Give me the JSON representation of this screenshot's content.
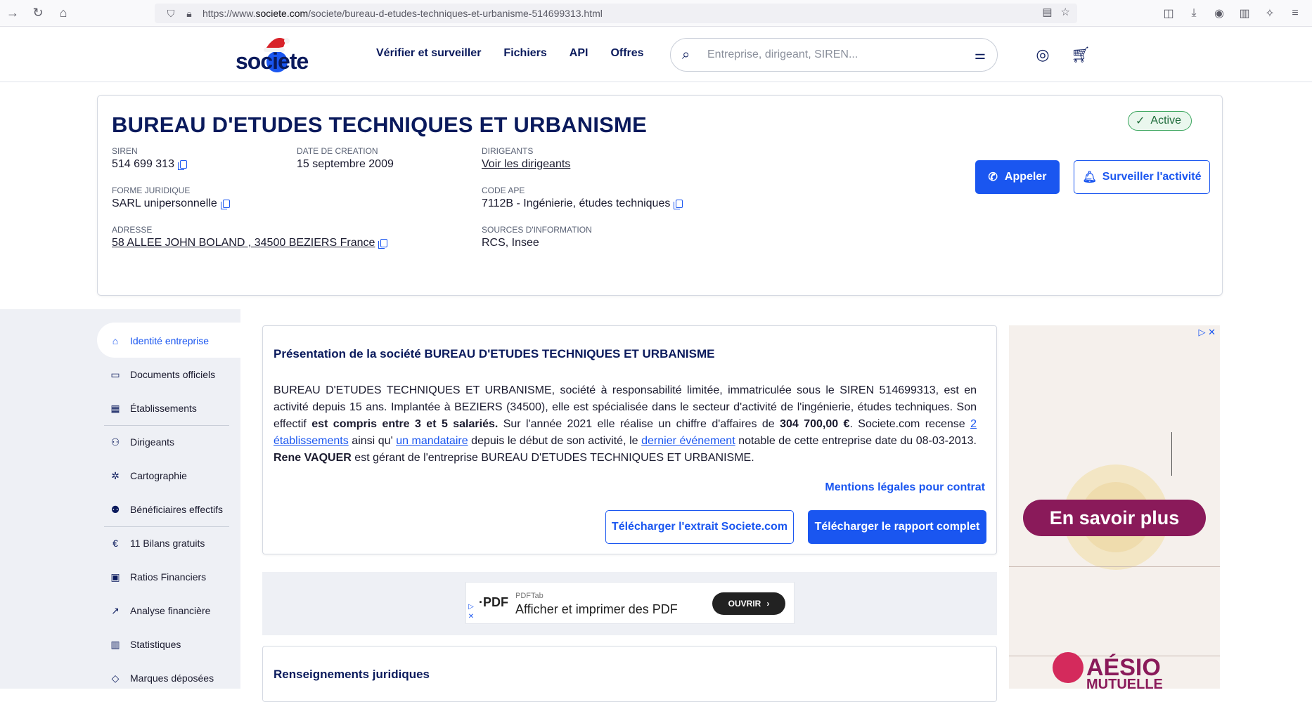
{
  "browser": {
    "url_prefix": "https://www.",
    "url_domain": "societe.com",
    "url_path": "/societe/bureau-d-etudes-techniques-et-urbanisme-514699313.html"
  },
  "header": {
    "logo_text": "societe",
    "nav": [
      "Vérifier et surveiller",
      "Fichiers",
      "API",
      "Offres"
    ],
    "search_placeholder": "Entreprise, dirigeant, SIREN..."
  },
  "company": {
    "name": "BUREAU D'ETUDES TECHNIQUES ET URBANISME",
    "status": "Active",
    "siren_label": "SIREN",
    "siren": "514 699 313",
    "creation_label": "DATE DE CREATION",
    "creation": "15 septembre 2009",
    "dirigeants_label": "DIRIGEANTS",
    "dirigeants": "Voir les dirigeants",
    "forme_label": "FORME JURIDIQUE",
    "forme": "SARL unipersonnelle",
    "ape_label": "CODE APE",
    "ape": "7112B - Ingénierie, études techniques",
    "adresse_label": "ADRESSE",
    "adresse": "58 ALLEE JOHN BOLAND , 34500 BEZIERS France",
    "sources_label": "SOURCES D'INFORMATION",
    "sources": "RCS, Insee",
    "call_label": "Appeler",
    "watch_label": "Surveiller l'activité"
  },
  "sidebar": {
    "items": [
      {
        "label": "Identité entreprise",
        "icon": "home-icon"
      },
      {
        "label": "Documents officiels",
        "icon": "folder-icon"
      },
      {
        "label": "Établissements",
        "icon": "building-icon"
      },
      {
        "label": "Dirigeants",
        "icon": "people-icon"
      },
      {
        "label": "Cartographie",
        "icon": "network-icon"
      },
      {
        "label": "Bénéficiaires effectifs",
        "icon": "group-icon"
      },
      {
        "label": "11 Bilans gratuits",
        "icon": "euro-icon"
      },
      {
        "label": "Ratios Financiers",
        "icon": "calculator-icon"
      },
      {
        "label": "Analyse financière",
        "icon": "trend-icon"
      },
      {
        "label": "Statistiques",
        "icon": "chart-icon"
      },
      {
        "label": "Marques déposées",
        "icon": "tag-icon"
      }
    ]
  },
  "presentation": {
    "title": "Présentation de la société BUREAU D'ETUDES TECHNIQUES ET URBANISME",
    "t1": "BUREAU D'ETUDES TECHNIQUES ET URBANISME, société à responsabilité limitée, immatriculée sous le SIREN 514699313, est en activité depuis 15 ans. Implantée à BEZIERS (34500), elle est spécialisée dans le secteur d'activité de l'ingénierie, études techniques. Son effectif ",
    "t2": "est compris entre 3 et 5 salariés.",
    "t3": " Sur l'année 2021 elle réalise un chiffre d'affaires de ",
    "t4": "304 700,00 €",
    "t5": ". Societe.com recense ",
    "l1": "2 établissements",
    "t6": "  ainsi qu' ",
    "l2": "un mandataire",
    "t7": " depuis le début de son activité, le ",
    "l3": "dernier événement",
    "t8": " notable de cette entreprise date du 08-03-2013. ",
    "t9": "Rene VAQUER",
    "t10": " est gérant de l'entreprise BUREAU D'ETUDES TECHNIQUES ET URBANISME.",
    "mentions": "Mentions légales pour contrat",
    "btn_extrait": "Télécharger l'extrait Societe.com",
    "btn_rapport": "Télécharger le rapport complet"
  },
  "pdf_ad": {
    "logo": "PDF",
    "small": "PDFTab",
    "main": "Afficher et imprimer des PDF",
    "button": "OUVRIR"
  },
  "juridique": {
    "title": "Renseignements juridiques"
  },
  "side_ad": {
    "cta": "En savoir plus",
    "brand": "AÉSIO",
    "brand_sub": "MUTUELLE"
  }
}
